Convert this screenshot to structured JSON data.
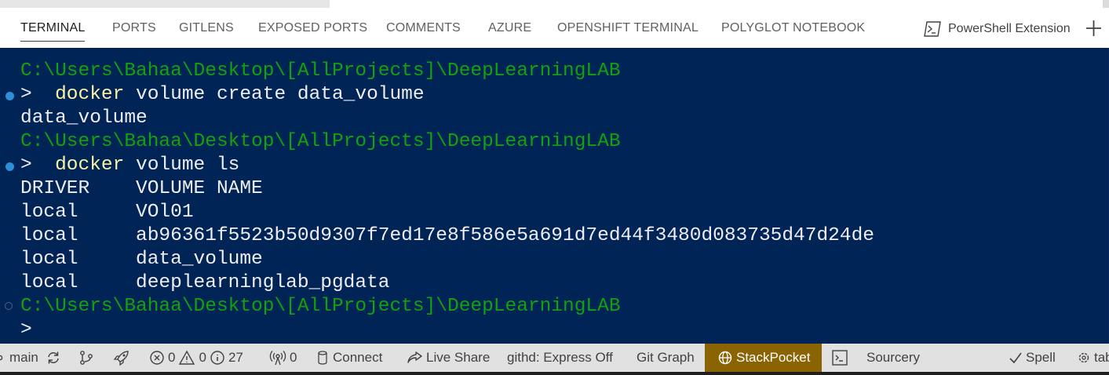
{
  "panel_tabs": [
    {
      "label": "TERMINAL",
      "active": true
    },
    {
      "label": "PORTS"
    },
    {
      "label": "GITLENS"
    },
    {
      "label": "EXPOSED PORTS"
    },
    {
      "label": "COMMENTS"
    },
    {
      "label": "AZURE"
    },
    {
      "label": "OPENSHIFT TERMINAL"
    },
    {
      "label": "POLYGLOT NOTEBOOK"
    }
  ],
  "terminal_profile": {
    "label": "PowerShell Extension",
    "icon": "terminal-icon"
  },
  "terminal": {
    "prompt_path": "C:\\Users\\Bahaa\\Desktop\\[AllProjects]\\DeepLearningLAB",
    "prompt_char": ">",
    "commands": [
      {
        "name": "docker",
        "args": " volume create data_volume"
      },
      {
        "name": "docker",
        "args": " volume ls"
      }
    ],
    "outputs": {
      "create_result": "data_volume",
      "ls_header": "DRIVER    VOLUME NAME",
      "ls_rows": [
        "local     VOl01",
        "local     ab96361f5523b50d9307f7ed17e8f586e5a691d7ed44f3480d083735d47d24de",
        "local     data_volume",
        "local     deeplearninglab_pgdata"
      ]
    }
  },
  "status_bar": {
    "branch": "main",
    "errors": "0",
    "warnings": "0",
    "infos": "27",
    "ports": "0",
    "connect": "Connect",
    "live_share": "Live Share",
    "githd": "githd: Express Off",
    "git_graph": "Git Graph",
    "stackpocket": "StackPocket",
    "sourcery": "Sourcery",
    "spell": "Spell",
    "tab": "tab"
  },
  "colors": {
    "terminal_bg": "#012456",
    "path_green": "#13a10e",
    "command_yellow": "#f9f1a5",
    "text": "#eeedf0",
    "statusbar_bg": "#e1e1e1",
    "stackpocket_bg": "#8a6302",
    "prompt_dot": "#2e8fd8"
  }
}
